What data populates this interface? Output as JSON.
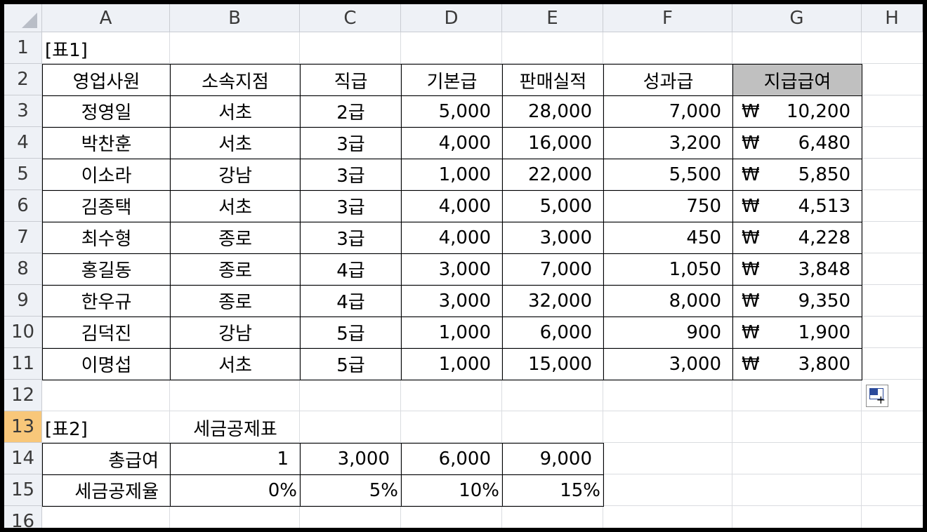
{
  "columns": [
    "A",
    "B",
    "C",
    "D",
    "E",
    "F",
    "G",
    "H"
  ],
  "rows": [
    "1",
    "2",
    "3",
    "4",
    "5",
    "6",
    "7",
    "8",
    "9",
    "10",
    "11",
    "12",
    "13",
    "14",
    "15",
    "16"
  ],
  "selected_row": "13",
  "table1": {
    "label": "[표1]",
    "headers": [
      "영업사원",
      "소속지점",
      "직급",
      "기본급",
      "판매실적",
      "성과급",
      "지급급여"
    ],
    "currency_symbol": "₩",
    "records": [
      [
        "정영일",
        "서초",
        "2급",
        "5,000",
        "28,000",
        "7,000",
        "10,200"
      ],
      [
        "박찬훈",
        "서초",
        "3급",
        "4,000",
        "16,000",
        "3,200",
        "6,480"
      ],
      [
        "이소라",
        "강남",
        "3급",
        "1,000",
        "22,000",
        "5,500",
        "5,850"
      ],
      [
        "김종택",
        "서초",
        "3급",
        "4,000",
        "5,000",
        "750",
        "4,513"
      ],
      [
        "최수형",
        "종로",
        "3급",
        "4,000",
        "3,000",
        "450",
        "4,228"
      ],
      [
        "홍길동",
        "종로",
        "4급",
        "3,000",
        "7,000",
        "1,050",
        "3,848"
      ],
      [
        "한우규",
        "종로",
        "4급",
        "3,000",
        "32,000",
        "8,000",
        "9,350"
      ],
      [
        "김덕진",
        "강남",
        "5급",
        "1,000",
        "6,000",
        "900",
        "1,900"
      ],
      [
        "이명섭",
        "서초",
        "5급",
        "1,000",
        "15,000",
        "3,000",
        "3,800"
      ]
    ]
  },
  "table2": {
    "label": "[표2]",
    "title": "세금공제표",
    "row1_label": "총급여",
    "row1_values": [
      "1",
      "3,000",
      "6,000",
      "9,000"
    ],
    "row2_label": "세금공제율",
    "row2_values": [
      "0%",
      "5%",
      "10%",
      "15%"
    ]
  },
  "colors": {
    "header_bg": "#eef1f6",
    "selected_row_bg": "#f8c77a",
    "highlight_header_bg": "#c0c0c0"
  }
}
